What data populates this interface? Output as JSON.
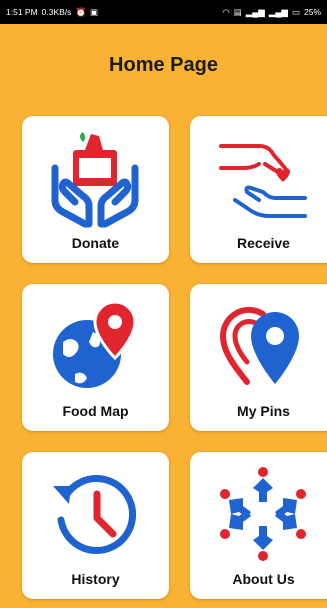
{
  "status_bar": {
    "time": "1:51 PM",
    "data_rate": "0.3KB/s",
    "battery": "25%"
  },
  "page_title": "Home Page",
  "menu": [
    {
      "label": "Donate",
      "icon": "donate-icon"
    },
    {
      "label": "Receive",
      "icon": "receive-icon"
    },
    {
      "label": "Food Map",
      "icon": "food-map-icon"
    },
    {
      "label": "My Pins",
      "icon": "my-pins-icon"
    },
    {
      "label": "History",
      "icon": "history-icon"
    },
    {
      "label": "About Us",
      "icon": "about-us-icon"
    }
  ],
  "colors": {
    "background": "#F9B233",
    "card": "#FFFFFF",
    "icon_blue": "#1E63D0",
    "icon_red": "#E0252F"
  }
}
